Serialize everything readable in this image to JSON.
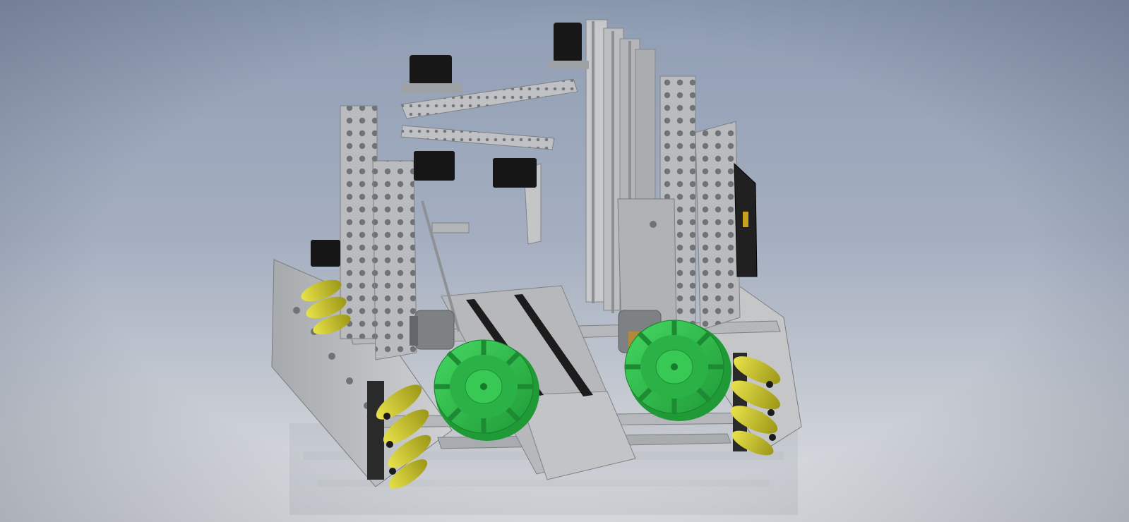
{
  "scene": {
    "subject": "",
    "colors": {
      "background_top": "#8f9db3",
      "background_bottom": "#dfe1e4",
      "aluminum": "#b9bbbe",
      "aluminum_dark": "#8d9093",
      "servo_black": "#161616",
      "compliant_wheel_green": "#2fbf4b",
      "mecanum_roller_yellow": "#c9c425",
      "motor_gray": "#7e8184",
      "brass": "#b08a3a"
    },
    "icons": [
      "mecanum-wheel",
      "compliant-wheel",
      "servo",
      "motor",
      "aluminum-channel",
      "ground-reflection"
    ]
  }
}
